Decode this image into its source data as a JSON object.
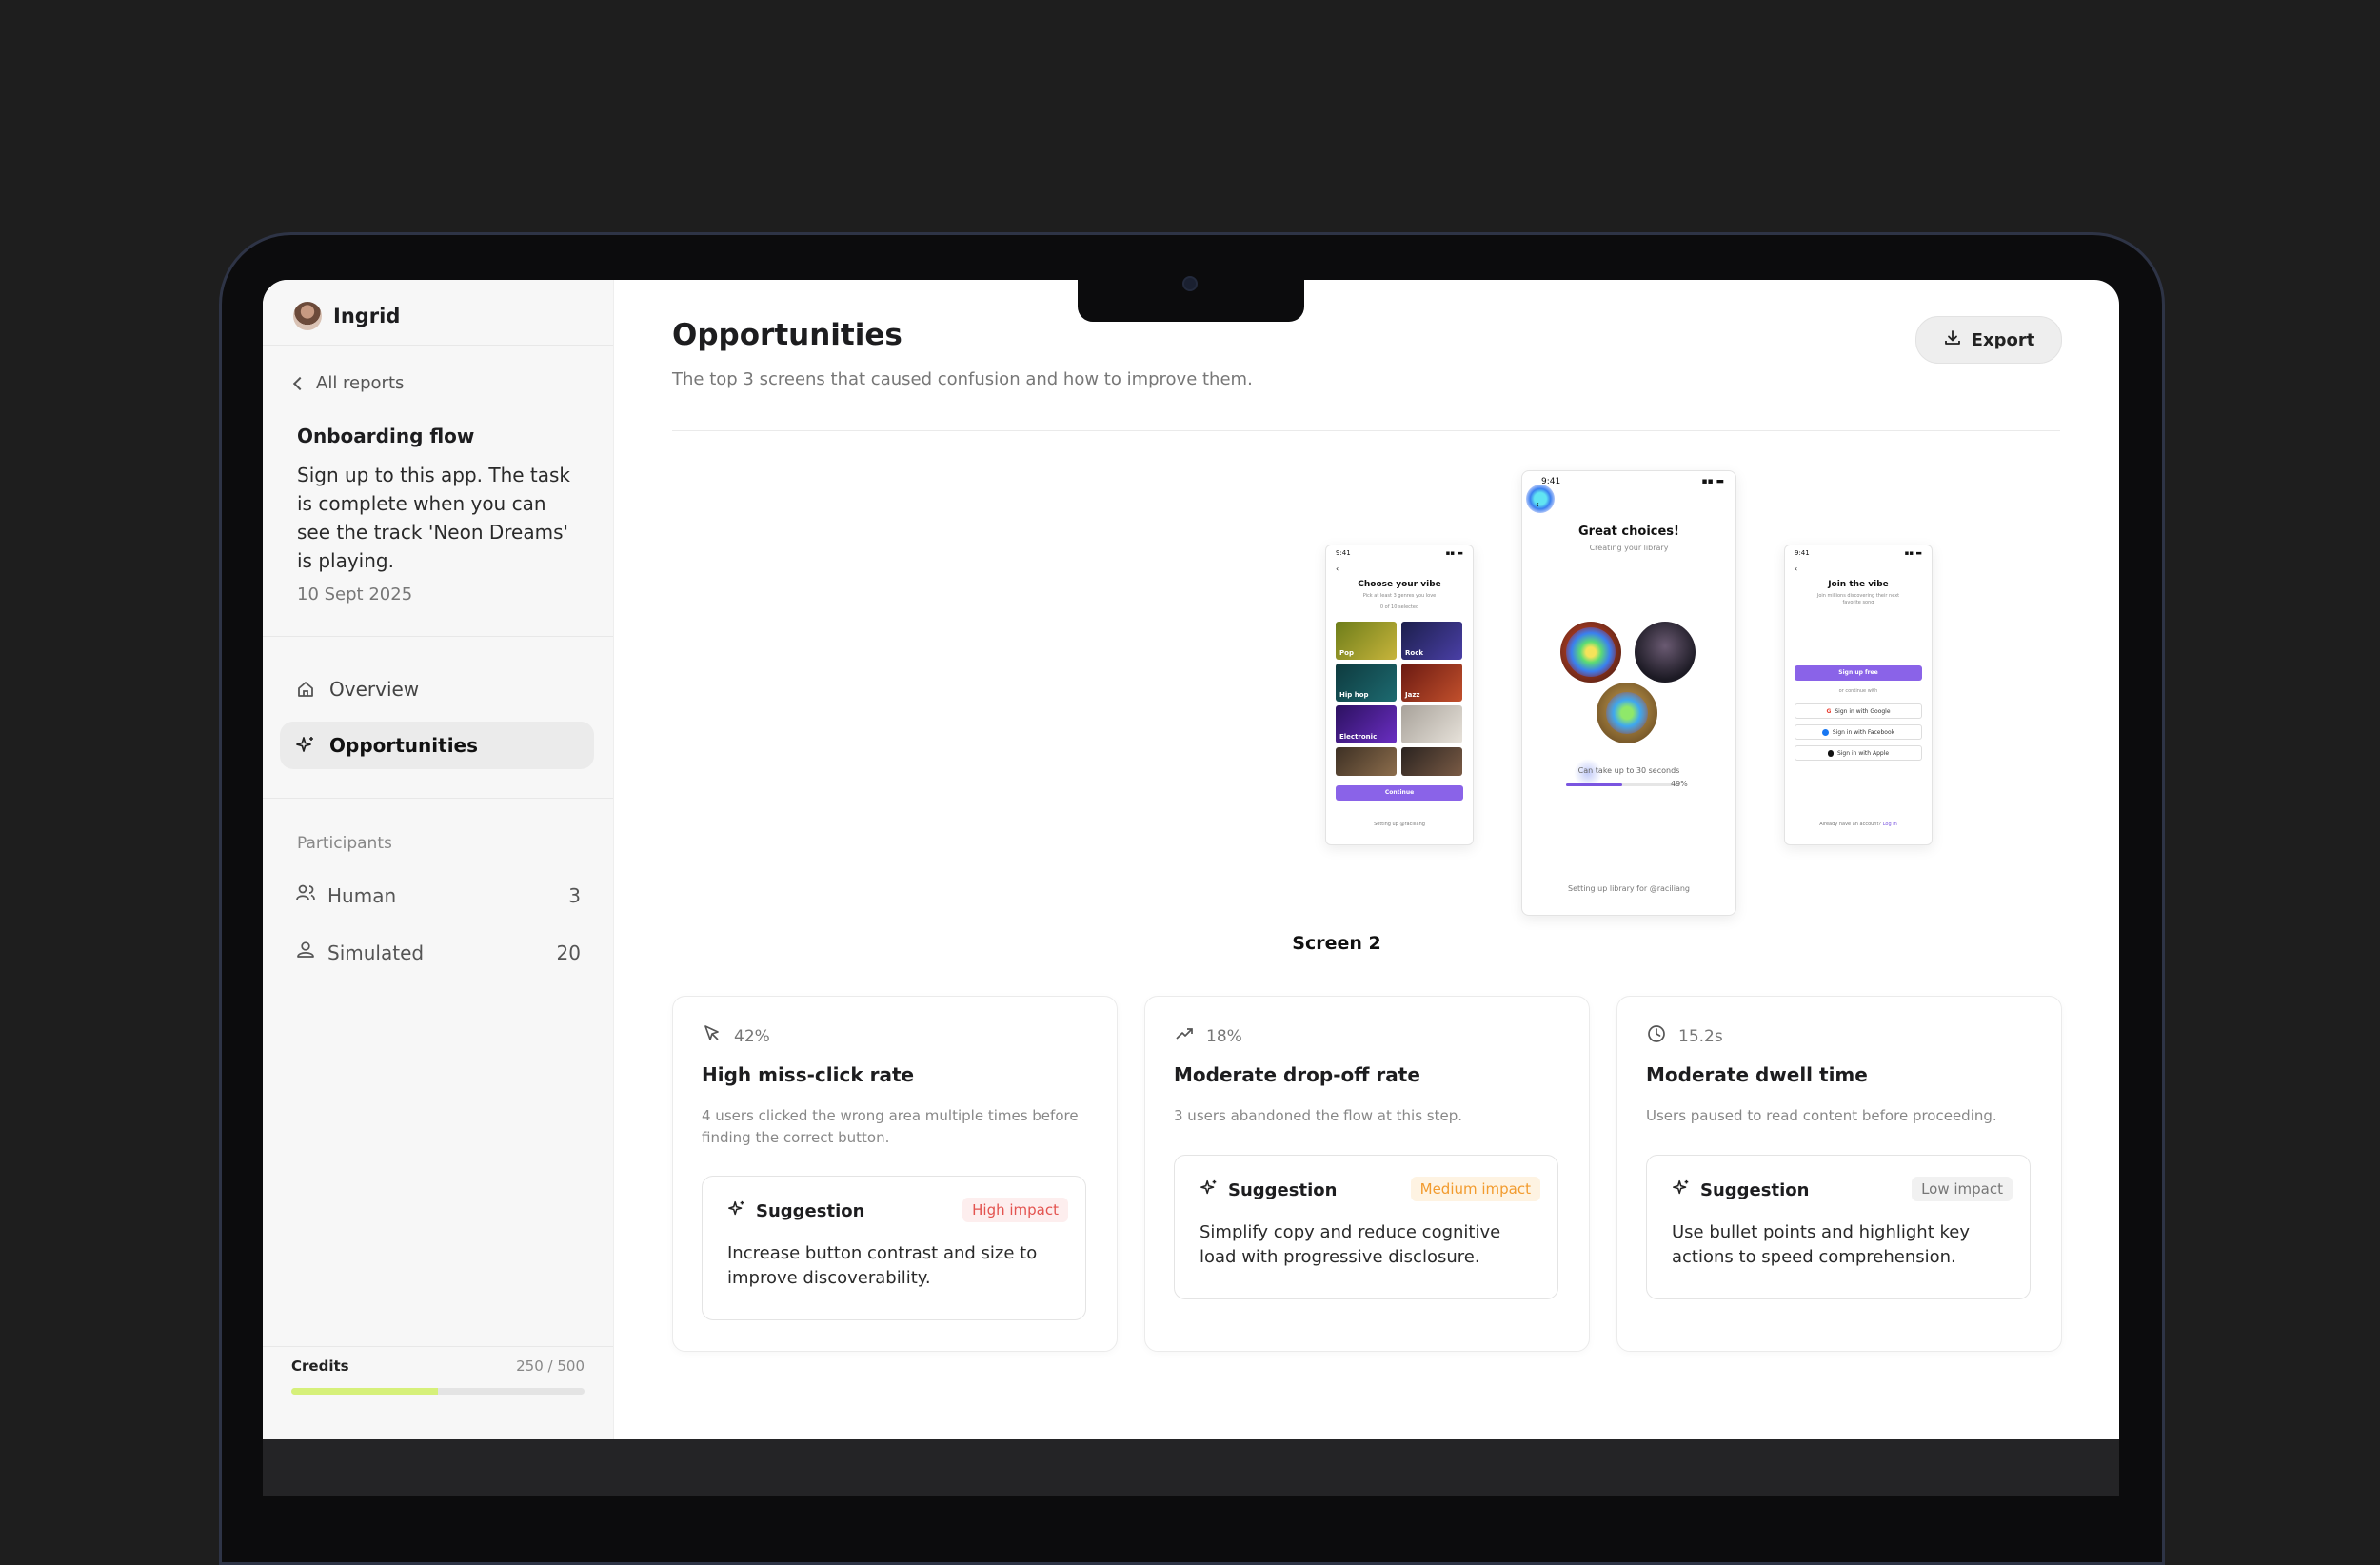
{
  "user": {
    "name": "Ingrid"
  },
  "sidebar": {
    "back_label": "All reports",
    "report_title": "Onboarding flow",
    "report_description": "Sign up to this app. The task is complete when you can see the track 'Neon Dreams' is playing.",
    "report_date": "10 Sept 2025",
    "nav": [
      {
        "label": "Overview",
        "icon": "home-icon",
        "active": false
      },
      {
        "label": "Opportunities",
        "icon": "sparkle-icon",
        "active": true
      }
    ],
    "participants_label": "Participants",
    "participants": [
      {
        "label": "Human",
        "count": "3",
        "icon": "users-icon"
      },
      {
        "label": "Simulated",
        "count": "20",
        "icon": "bot-user-icon"
      }
    ],
    "credits": {
      "label": "Credits",
      "value_text": "250 / 500",
      "fraction": 0.5,
      "fill_color": "#d6f07a"
    }
  },
  "main": {
    "title": "Opportunities",
    "subtitle": "The top 3 screens that caused confusion and how to improve them.",
    "export_label": "Export",
    "screen_label": "Screen 2",
    "phones": {
      "left": {
        "time": "9:41",
        "title": "Choose your vibe",
        "subtitle": "Pick at least 3 genres you love",
        "counter": "0 of 10 selected",
        "genres": [
          "Pop",
          "Rock",
          "Hip hop",
          "Jazz",
          "Electronic",
          "",
          "",
          ""
        ],
        "button": "Continue",
        "footer": "Setting up @raciliang"
      },
      "center": {
        "time": "9:41",
        "title": "Great choices!",
        "subtitle": "Creating your library",
        "progress_text": "Can take up to 30 seconds",
        "progress_value": "49%",
        "progress_fraction": 0.49,
        "footer": "Setting up library for @raciliang"
      },
      "right": {
        "time": "9:41",
        "title": "Join the vibe",
        "subtitle": "Join millions discovering their next favorite song",
        "button": "Sign up free",
        "divider": "or continue with",
        "social": [
          "Sign in with Google",
          "Sign in with Facebook",
          "Sign in with Apple"
        ],
        "footer_text": "Already have an account?",
        "footer_link": "Log in"
      }
    },
    "cards": [
      {
        "metric": "42%",
        "metric_icon": "cursor-icon",
        "title": "High miss-click rate",
        "description": "4 users clicked the wrong area multiple times before finding the correct button.",
        "suggestion_label": "Suggestion",
        "impact": "High impact",
        "suggestion": "Increase button contrast and size to improve discoverability."
      },
      {
        "metric": "18%",
        "metric_icon": "trend-up-icon",
        "title": "Moderate drop-off rate",
        "description": "3 users abandoned the flow at this step.",
        "suggestion_label": "Suggestion",
        "impact": "Medium impact",
        "suggestion": "Simplify copy and reduce cognitive load with progressive disclosure."
      },
      {
        "metric": "15.2s",
        "metric_icon": "clock-icon",
        "title": "Moderate dwell time",
        "description": "Users paused to read content before proceeding.",
        "suggestion_label": "Suggestion",
        "impact": "Low impact",
        "suggestion": "Use bullet points and highlight key actions to speed comprehension."
      }
    ]
  }
}
